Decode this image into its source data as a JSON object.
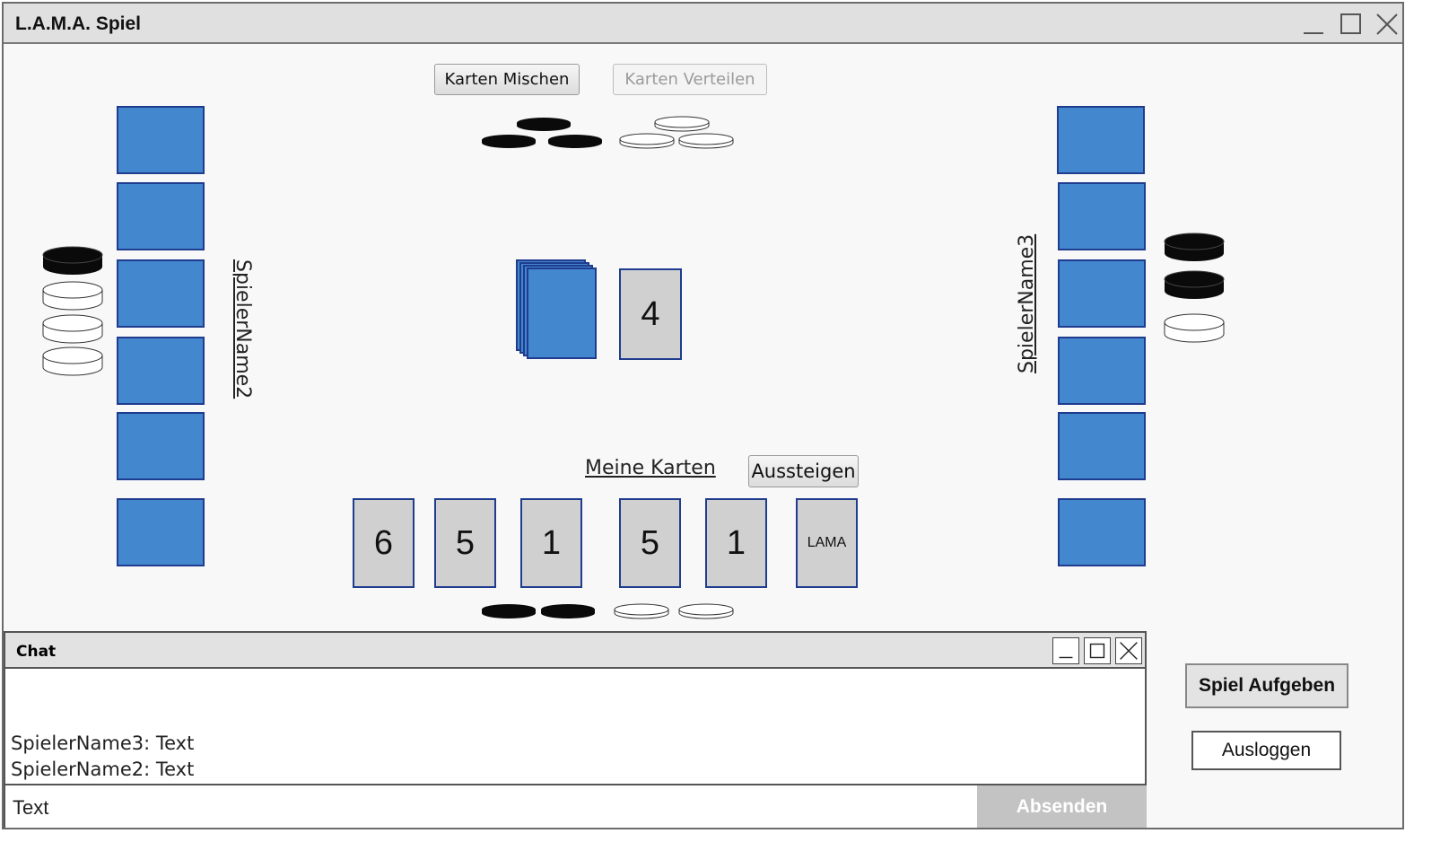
{
  "window": {
    "title": "L.A.M.A. Spiel"
  },
  "top_controls": {
    "shuffle_label": "Karten Mischen",
    "deal_label": "Karten Verteilen"
  },
  "center": {
    "discard_value": "4"
  },
  "players": {
    "left": {
      "name": "SpielerName2",
      "hand_count": 6
    },
    "right": {
      "name": "SpielerName3",
      "hand_count": 6
    }
  },
  "me": {
    "label": "Meine Karten",
    "leave_label": "Aussteigen",
    "cards": [
      "6",
      "5",
      "1",
      "5",
      "1",
      "LAMA"
    ]
  },
  "chat": {
    "title": "Chat",
    "messages": [
      "SpielerName3: Text",
      "SpielerName2: Text"
    ],
    "input_value": "Text",
    "send_label": "Absenden"
  },
  "actions": {
    "give_up_label": "Spiel Aufgeben",
    "logout_label": "Ausloggen"
  },
  "colors": {
    "card_back": "#4388cf",
    "card_border": "#1f3c8e",
    "card_face": "#d0d0d0",
    "chip_black": "#0a0a0a",
    "chip_white": "#ffffff"
  }
}
